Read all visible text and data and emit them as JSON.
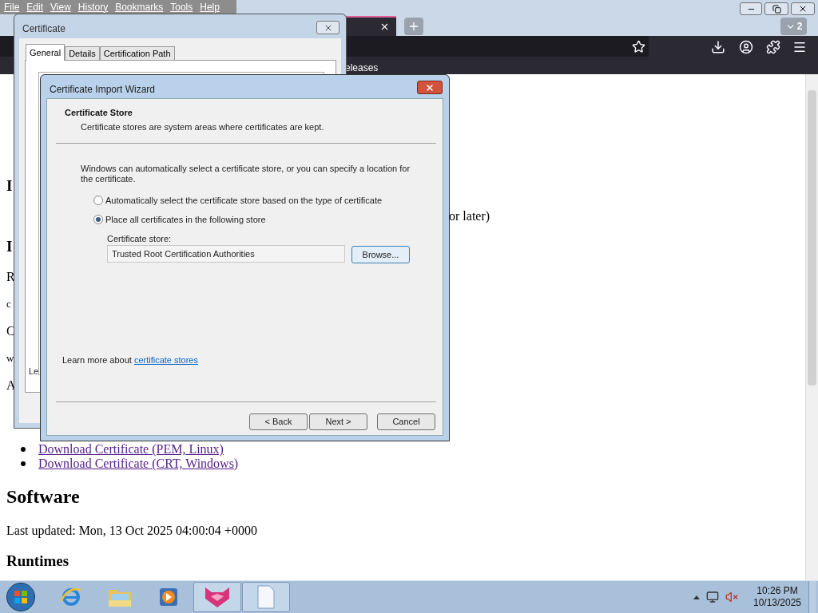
{
  "browser": {
    "menu": [
      "File",
      "Edit",
      "View",
      "History",
      "Bookmarks",
      "Tools",
      "Help"
    ],
    "tab_count": "2",
    "bookmark": "eleases"
  },
  "page": {
    "rows": [
      {
        "kind": "h1"
      },
      {
        "kind": "h2"
      },
      {
        "kind": "h3",
        "text": "I"
      },
      {
        "kind": "p",
        "right": "or later)"
      },
      {
        "kind": "h3",
        "text": "I"
      },
      {
        "kind": "p",
        "text": "R"
      },
      {
        "kind": "small",
        "text": "c"
      },
      {
        "kind": "p",
        "text": "C"
      },
      {
        "kind": "small",
        "text": "w"
      },
      {
        "kind": "p",
        "text": "A"
      },
      {
        "kind": "h3"
      }
    ],
    "links": [
      "Download Certificate (PEM, Linux)",
      "Download Certificate (CRT, Windows)"
    ],
    "heading": "Software",
    "updated": "Last updated: Mon, 13 Oct 2025 04:00:04 +0000",
    "subheading": "Runtimes"
  },
  "certificate_dialog": {
    "title": "Certificate",
    "tabs": [
      {
        "label": "General",
        "selected": true
      },
      {
        "label": "Details",
        "selected": false
      },
      {
        "label": "Certification Path",
        "selected": false
      }
    ],
    "partial_text": "Le"
  },
  "wizard": {
    "title": "Certificate Import Wizard",
    "section_title": "Certificate Store",
    "section_description": "Certificate stores are system areas where certificates are kept.",
    "intro": "Windows can automatically select a certificate store, or you can specify a location for the certificate.",
    "options": [
      {
        "label": "Automatically select the certificate store based on the type of certificate",
        "selected": false
      },
      {
        "label": "Place all certificates in the following store",
        "selected": true
      }
    ],
    "store_label": "Certificate store:",
    "store_value": "Trusted Root Certification Authorities",
    "browse": "Browse...",
    "learn_more_prefix": "Learn more about",
    "learn_more_link": "certificate stores",
    "buttons": [
      "< Back",
      "Next >",
      "Cancel"
    ]
  },
  "taskbar": {
    "apps": [
      {
        "kind": "ie",
        "running": false
      },
      {
        "kind": "explorer",
        "running": false
      },
      {
        "kind": "media",
        "running": false
      },
      {
        "kind": "fox",
        "running": true
      },
      {
        "kind": "document",
        "running": true
      }
    ],
    "time": "10:26 PM",
    "date": "10/13/2025"
  }
}
